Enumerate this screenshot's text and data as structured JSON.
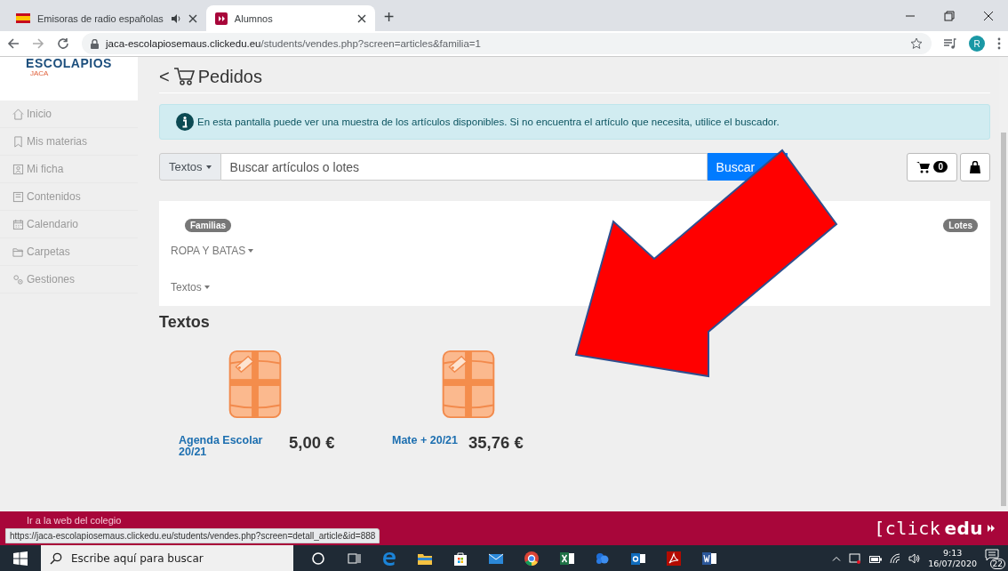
{
  "browser": {
    "tabs": [
      {
        "title": "Emisoras de radio españolas",
        "selected": false,
        "audio": true
      },
      {
        "title": "Alumnos",
        "selected": true,
        "audio": false
      }
    ],
    "new_tab": "+",
    "url_host": "jaca-escolapiosemaus.clickedu.eu",
    "url_path": "/students/vendes.php?screen=articles&familia=1",
    "profile_initial": "R"
  },
  "sidebar": {
    "logo": "ESCOLAPIOS",
    "logo_sub": "JACA",
    "items": [
      {
        "label": "Inicio"
      },
      {
        "label": "Mis materias"
      },
      {
        "label": "Mi ficha"
      },
      {
        "label": "Contenidos"
      },
      {
        "label": "Calendario"
      },
      {
        "label": "Carpetas"
      },
      {
        "label": "Gestiones"
      }
    ]
  },
  "page": {
    "back": "<",
    "title": "Pedidos",
    "info": "En esta pantalla puede ver una muestra de los artículos disponibles. Si no encuentra el artículo que necesita, utilice el buscador.",
    "search": {
      "dropdown": "Textos",
      "placeholder": "Buscar artículos o lotes",
      "button": "Buscar"
    },
    "cart_count": "0",
    "families_badge": "Familias",
    "lots_badge": "Lotes",
    "families": [
      {
        "label": "ROPA Y BATAS"
      },
      {
        "label": "Textos"
      }
    ],
    "section": "Textos",
    "products": [
      {
        "name": "Agenda Escolar 20/21",
        "price": "5,00 €"
      },
      {
        "name": "Mate + 20/21",
        "price": "35,76 €"
      }
    ]
  },
  "footer": {
    "link": "Ir a la web del colegio",
    "brand_light": "[click",
    "brand_bold": "edu"
  },
  "status_url": "https://jaca-escolapiosemaus.clickedu.eu/students/vendes.php?screen=detall_article&id=888",
  "taskbar": {
    "search_placeholder": "Escribe aquí para buscar",
    "time": "9:13",
    "date": "16/07/2020",
    "notifications": "22"
  }
}
